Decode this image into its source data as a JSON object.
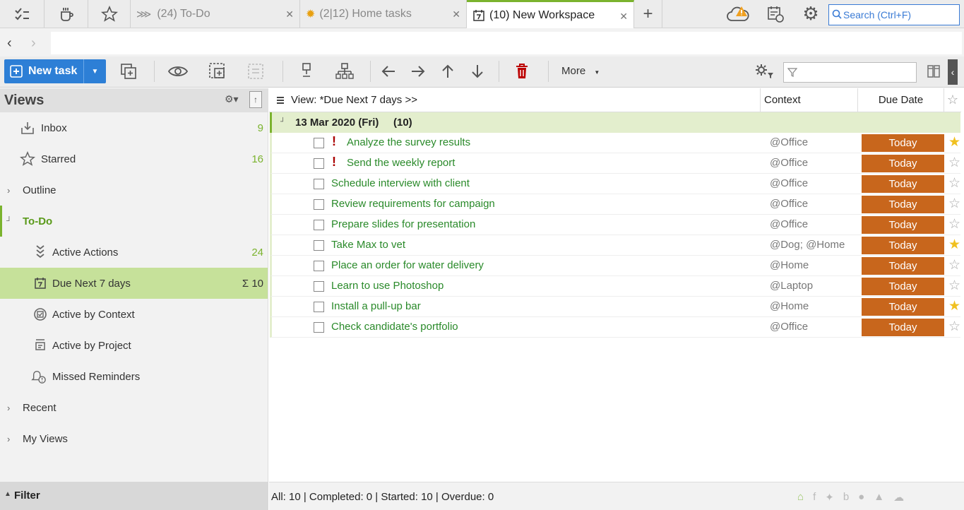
{
  "tabs": {
    "items": [
      {
        "label": "(24) To-Do"
      },
      {
        "label": "(2|12) Home tasks"
      },
      {
        "label": "(10) New Workspace"
      }
    ],
    "add_label": "+",
    "search_placeholder": "Search (Ctrl+F)"
  },
  "toolbar": {
    "new_task_label": "New task",
    "more_label": "More"
  },
  "sidebar": {
    "title": "Views",
    "items": [
      {
        "label": "Inbox",
        "count": "9"
      },
      {
        "label": "Starred",
        "count": "16"
      },
      {
        "label": "Outline",
        "count": ""
      },
      {
        "label": "To-Do",
        "count": ""
      },
      {
        "label": "Active Actions",
        "count": "24"
      },
      {
        "label": "Due Next 7 days",
        "count": "Σ 10"
      },
      {
        "label": "Active by Context",
        "count": ""
      },
      {
        "label": "Active by Project",
        "count": ""
      },
      {
        "label": "Missed Reminders",
        "count": ""
      },
      {
        "label": "Recent",
        "count": ""
      },
      {
        "label": "My Views",
        "count": ""
      }
    ],
    "filter_label": "Filter"
  },
  "main": {
    "view_label": "View: *Due Next 7 days >>",
    "col_context": "Context",
    "col_due": "Due Date",
    "group_label": "13 Mar 2020 (Fri)",
    "group_count": "(10)",
    "tasks": [
      {
        "title": "Analyze the survey results",
        "context": "@Office",
        "due": "Today",
        "starred": true,
        "important": true
      },
      {
        "title": "Send the weekly report",
        "context": "@Office",
        "due": "Today",
        "starred": false,
        "important": true
      },
      {
        "title": "Schedule interview with client",
        "context": "@Office",
        "due": "Today",
        "starred": false,
        "important": false
      },
      {
        "title": "Review requirements for campaign",
        "context": "@Office",
        "due": "Today",
        "starred": false,
        "important": false
      },
      {
        "title": "Prepare slides for presentation",
        "context": "@Office",
        "due": "Today",
        "starred": false,
        "important": false
      },
      {
        "title": "Take Max to vet",
        "context": "@Dog; @Home",
        "due": "Today",
        "starred": true,
        "important": false
      },
      {
        "title": "Place an order for water delivery",
        "context": "@Home",
        "due": "Today",
        "starred": false,
        "important": false
      },
      {
        "title": "Learn to use Photoshop",
        "context": "@Laptop",
        "due": "Today",
        "starred": false,
        "important": false
      },
      {
        "title": "Install a pull-up bar",
        "context": "@Home",
        "due": "Today",
        "starred": true,
        "important": false
      },
      {
        "title": "Check candidate's portfolio",
        "context": "@Office",
        "due": "Today",
        "starred": false,
        "important": false
      }
    ],
    "status_text": "All: 10 | Completed: 0 | Started: 10 | Overdue: 0"
  },
  "colors": {
    "accent": "#7bb32e",
    "due_badge": "#c8661c",
    "primary_button": "#2d7fd6",
    "task_title": "#2a8a2a",
    "star_on": "#f0c020"
  }
}
